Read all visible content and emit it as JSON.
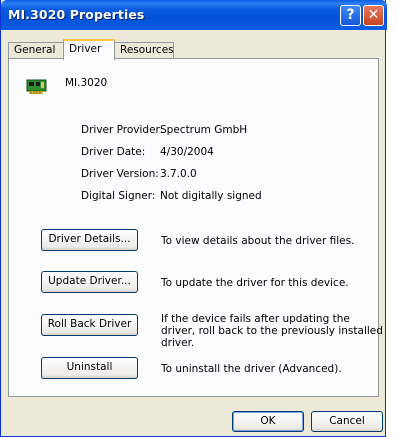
{
  "window": {
    "title": "MI.3020 Properties",
    "help_label": "?",
    "close_label": "✕"
  },
  "tabs": [
    {
      "label": "General"
    },
    {
      "label": "Driver"
    },
    {
      "label": "Resources"
    }
  ],
  "device": {
    "name": "MI.3020",
    "icon": "pci-card-icon"
  },
  "properties": {
    "provider_label": "Driver Provider:",
    "provider_value": "Spectrum GmbH",
    "date_label": "Driver Date:",
    "date_value": "4/30/2004",
    "version_label": "Driver Version:",
    "version_value": "3.7.0.0",
    "signer_label": "Digital Signer:",
    "signer_value": "Not digitally signed"
  },
  "actions": {
    "details_label": "Driver Details...",
    "details_desc": "To view details about the driver files.",
    "update_label": "Update Driver...",
    "update_desc": "To update the driver for this device.",
    "rollback_label": "Roll Back Driver",
    "rollback_desc": "If the device fails after updating the driver, roll back to the previously installed driver.",
    "uninstall_label": "Uninstall",
    "uninstall_desc": "To uninstall the driver (Advanced)."
  },
  "footer": {
    "ok_label": "OK",
    "cancel_label": "Cancel"
  }
}
